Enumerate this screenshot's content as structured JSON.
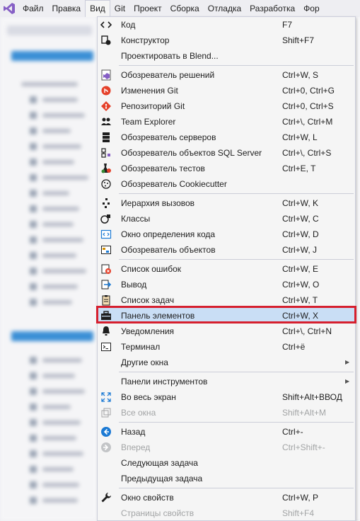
{
  "menubar": {
    "items": [
      "Файл",
      "Правка",
      "Вид",
      "Git",
      "Проект",
      "Сборка",
      "Отладка",
      "Разработка",
      "Фор"
    ]
  },
  "menu": {
    "rows": [
      {
        "label": "Код",
        "shortcut": "F7",
        "icon": "code-icon"
      },
      {
        "label": "Конструктор",
        "shortcut": "Shift+F7",
        "icon": "designer-icon"
      },
      {
        "label": "Проектировать в Blend...",
        "shortcut": "",
        "icon": ""
      },
      {
        "label": "Обозреватель решений",
        "shortcut": "Ctrl+W, S",
        "icon": "solution-explorer-icon"
      },
      {
        "label": "Изменения Git",
        "shortcut": "Ctrl+0, Ctrl+G",
        "icon": "git-changes-icon"
      },
      {
        "label": "Репозиторий Git",
        "shortcut": "Ctrl+0, Ctrl+S",
        "icon": "git-repository-icon"
      },
      {
        "label": "Team Explorer",
        "shortcut": "Ctrl+\\, Ctrl+M",
        "icon": "team-explorer-icon"
      },
      {
        "label": "Обозреватель серверов",
        "shortcut": "Ctrl+W, L",
        "icon": "server-explorer-icon"
      },
      {
        "label": "Обозреватель объектов SQL Server",
        "shortcut": "Ctrl+\\, Ctrl+S",
        "icon": "sql-object-explorer-icon"
      },
      {
        "label": "Обозреватель тестов",
        "shortcut": "Ctrl+E, T",
        "icon": "test-explorer-icon"
      },
      {
        "label": "Обозреватель Cookiecutter",
        "shortcut": "",
        "icon": "cookiecutter-icon"
      },
      {
        "label": "Иерархия вызовов",
        "shortcut": "Ctrl+W, K",
        "icon": "call-hierarchy-icon"
      },
      {
        "label": "Классы",
        "shortcut": "Ctrl+W, C",
        "icon": "class-view-icon"
      },
      {
        "label": "Окно определения кода",
        "shortcut": "Ctrl+W, D",
        "icon": "code-definition-icon"
      },
      {
        "label": "Обозреватель объектов",
        "shortcut": "Ctrl+W, J",
        "icon": "object-browser-icon"
      },
      {
        "label": "Список ошибок",
        "shortcut": "Ctrl+W, E",
        "icon": "error-list-icon"
      },
      {
        "label": "Вывод",
        "shortcut": "Ctrl+W, O",
        "icon": "output-icon"
      },
      {
        "label": "Список задач",
        "shortcut": "Ctrl+W, T",
        "icon": "task-list-icon"
      },
      {
        "label": "Панель элементов",
        "shortcut": "Ctrl+W, X",
        "icon": "toolbox-icon"
      },
      {
        "label": "Уведомления",
        "shortcut": "Ctrl+\\, Ctrl+N",
        "icon": "bell-icon"
      },
      {
        "label": "Терминал",
        "shortcut": "Ctrl+ё",
        "icon": "terminal-icon"
      },
      {
        "label": "Другие окна",
        "shortcut": "",
        "icon": ""
      },
      {
        "label": "Панели инструментов",
        "shortcut": "",
        "icon": ""
      },
      {
        "label": "Во весь экран",
        "shortcut": "Shift+Alt+ВВОД",
        "icon": "fullscreen-icon"
      },
      {
        "label": "Все окна",
        "shortcut": "Shift+Alt+M",
        "icon": "all-windows-icon"
      },
      {
        "label": "Назад",
        "shortcut": "Ctrl+-",
        "icon": "back-icon"
      },
      {
        "label": "Вперед",
        "shortcut": "Ctrl+Shift+-",
        "icon": "forward-icon"
      },
      {
        "label": "Следующая задача",
        "shortcut": "",
        "icon": ""
      },
      {
        "label": "Предыдущая задача",
        "shortcut": "",
        "icon": ""
      },
      {
        "label": "Окно свойств",
        "shortcut": "Ctrl+W, P",
        "icon": "wrench-icon"
      },
      {
        "label": "Страницы свойств",
        "shortcut": "Shift+F4",
        "icon": ""
      }
    ]
  },
  "colors": {
    "highlight": "#c9def5",
    "annotation_box": "#d61f2e",
    "disabled_text": "#a2a4a5"
  }
}
